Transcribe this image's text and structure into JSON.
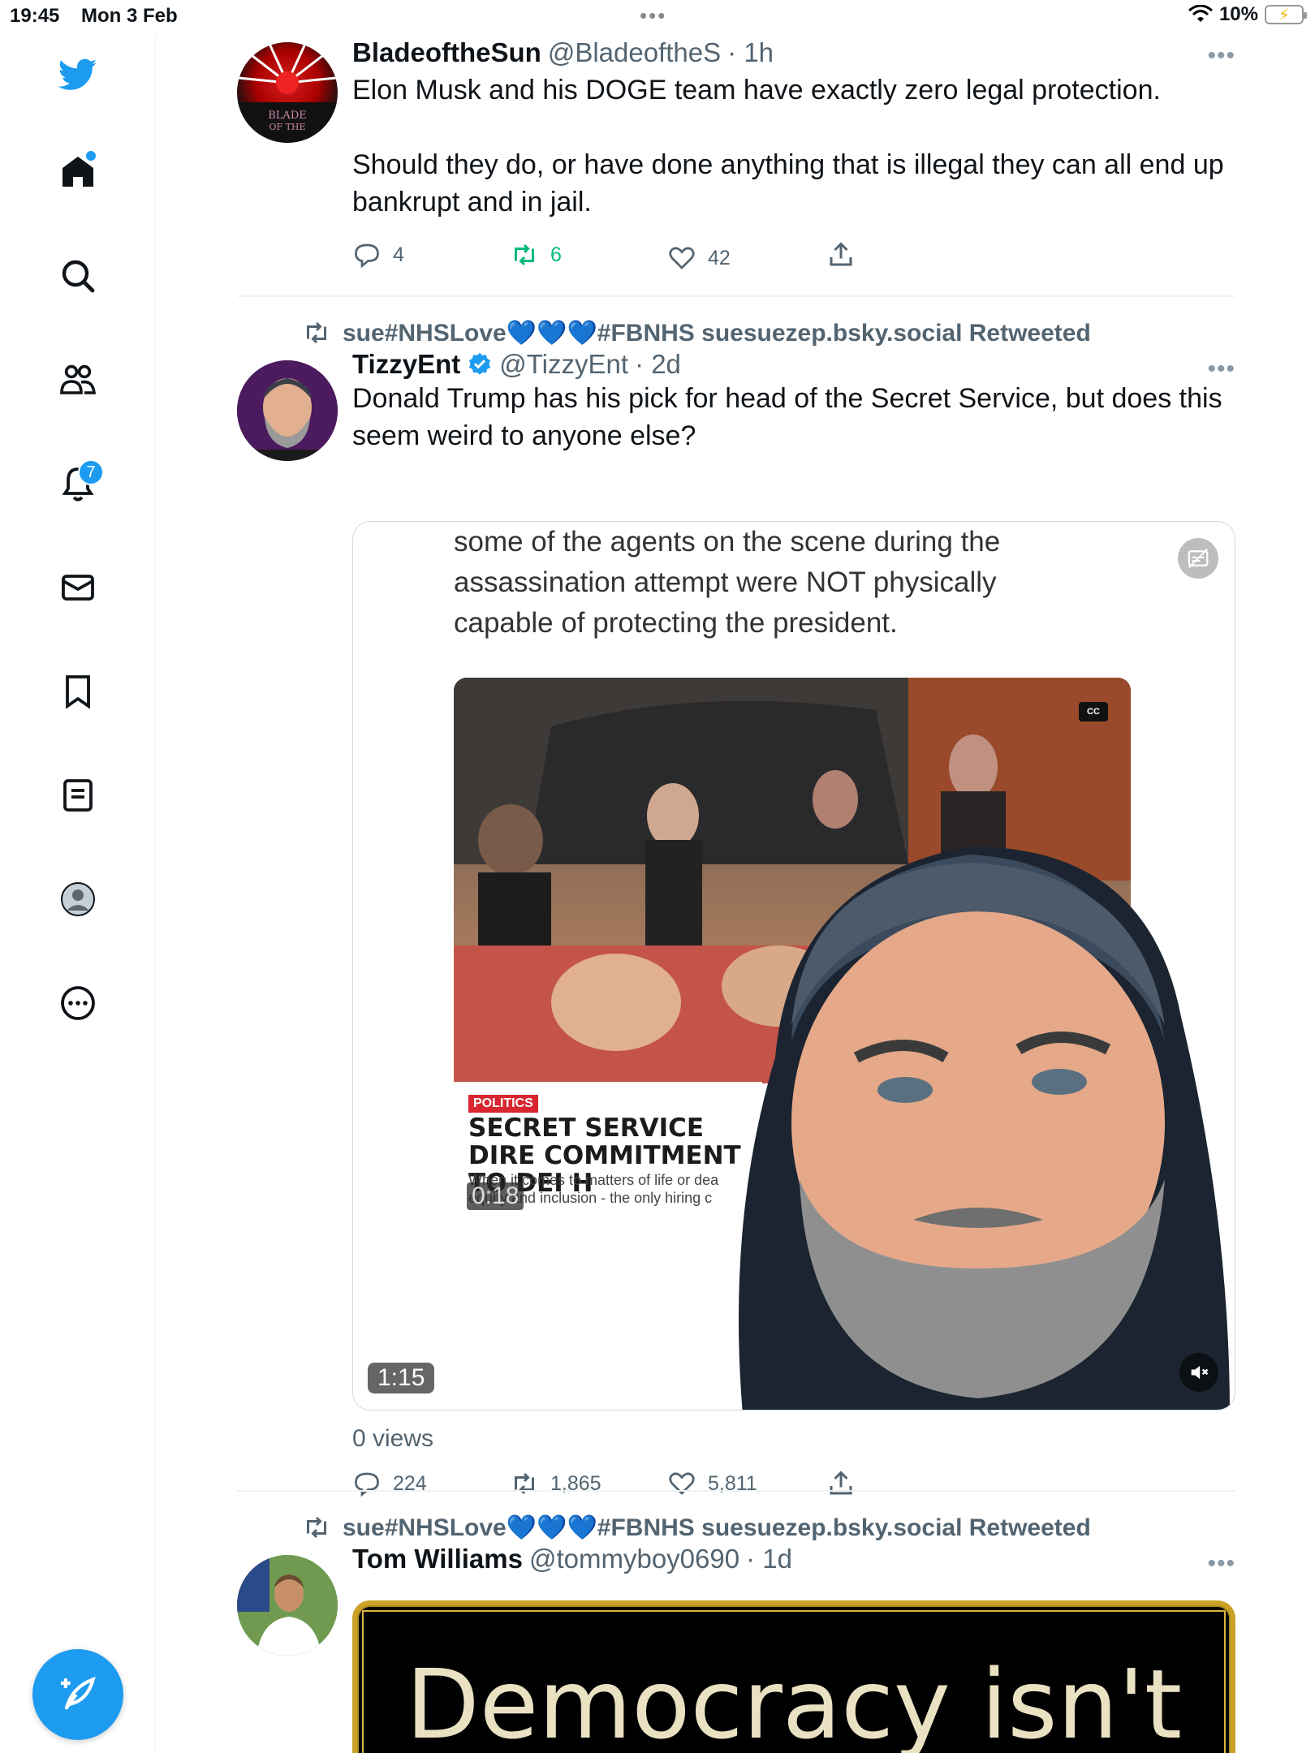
{
  "status_bar": {
    "time": "19:45",
    "date": "Mon 3 Feb",
    "battery": "10%",
    "dots": "•••"
  },
  "sidebar": {
    "items": [
      {
        "name": "home",
        "icon": "home-icon"
      },
      {
        "name": "explore",
        "icon": "search-icon"
      },
      {
        "name": "communities",
        "icon": "people-icon"
      },
      {
        "name": "notifications",
        "icon": "bell-icon",
        "badge": "7"
      },
      {
        "name": "messages",
        "icon": "mail-icon"
      },
      {
        "name": "bookmarks",
        "icon": "bookmark-icon"
      },
      {
        "name": "lists",
        "icon": "list-icon"
      },
      {
        "name": "profile",
        "icon": "profile-icon"
      },
      {
        "name": "more",
        "icon": "more-circle-icon"
      }
    ],
    "brand_color": "#1d9bf0"
  },
  "tweets": [
    {
      "name": "BladeoftheSun",
      "handle": "@BladeoftheS",
      "time": "· 1h",
      "text_1": "Elon Musk and his DOGE team have exactly zero legal protection.",
      "text_2": "Should they do, or have done anything that is illegal they can all end up bankrupt and in jail.",
      "avatar_text": "BLADE OF THE",
      "replies": "4",
      "retweets": "6",
      "likes": "42"
    },
    {
      "retweeted_by": "sue#NHSLove💙💙💙#FBNHS suesuezep.bsky.social Retweeted",
      "name": "TizzyEnt",
      "handle": "@TizzyEnt",
      "time": "· 2d",
      "text": "Donald Trump has his pick for head of the Secret Service, but does this seem weird to anyone else?",
      "video": {
        "caption": "some of the agents on the scene during the assassination attempt were NOT physically capable of protecting the president.",
        "news_tag": "POLITICS",
        "news_headline": "SECRET SERVICE DIRE COMMITMENT TO DEI H",
        "news_sub": "When it comes to matters of life or dea equity and inclusion - the only hiring c",
        "inner_time": "0:18",
        "cc": "CC",
        "duration": "1:15"
      },
      "views": "0 views",
      "replies": "224",
      "retweets": "1,865",
      "likes": "5,811"
    },
    {
      "retweeted_by": "sue#NHSLove💙💙💙#FBNHS suesuezep.bsky.social Retweeted",
      "name": "Tom Williams",
      "handle": "@tommyboy0690",
      "time": "· 1d",
      "image_text": "Democracy isn't"
    }
  ]
}
